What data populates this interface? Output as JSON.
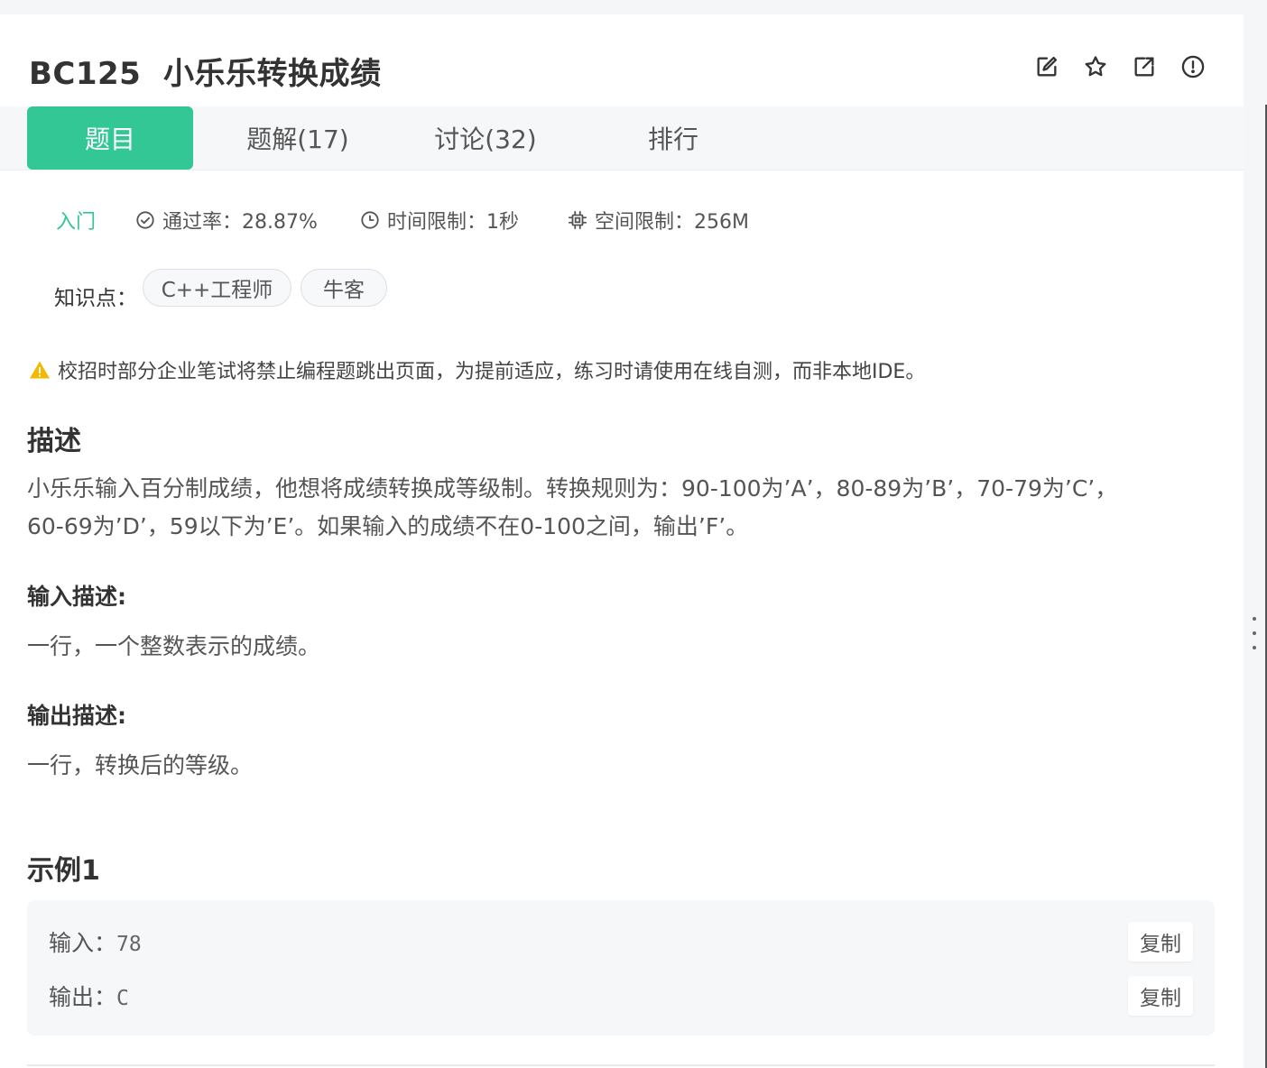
{
  "problem": {
    "title": "BC125  小乐乐转换成绩"
  },
  "header_icons": [
    "edit-icon",
    "star-icon",
    "external-link-icon",
    "alert-circle-icon"
  ],
  "tabs": [
    {
      "label": "题目",
      "active": true
    },
    {
      "label": "题解(17)",
      "active": false
    },
    {
      "label": "讨论(32)",
      "active": false
    },
    {
      "label": "排行",
      "active": false
    }
  ],
  "meta": {
    "level": "入门",
    "pass_rate": "通过率：28.87%",
    "time_limit": "时间限制：1秒",
    "space_limit": "空间限制：256M"
  },
  "knowledge": {
    "label": "知识点：",
    "tags": [
      "C++工程师",
      "牛客"
    ]
  },
  "warning": "校招时部分企业笔试将禁止编程题跳出页面，为提前适应，练习时请使用在线自测，而非本地IDE。",
  "description": {
    "heading": "描述",
    "line1": "小乐乐输入百分制成绩，他想将成绩转换成等级制。转换规则为：90-100为’A’，80-89为’B’，70-79为’C’，",
    "line2": "60-69为’D’，59以下为’E’。如果输入的成绩不在0-100之间，输出’F’。"
  },
  "input_desc": {
    "heading": "输入描述:",
    "text": "一行，一个整数表示的成绩。"
  },
  "output_desc": {
    "heading": "输出描述:",
    "text": "一行，转换后的等级。"
  },
  "example": {
    "heading": "示例1",
    "input_label": "输入：",
    "input_value": "78",
    "output_label": "输出：",
    "output_value": "C",
    "copy_label": "复制"
  },
  "colors": {
    "accent": "#32c794",
    "warning": "#f5b800"
  }
}
